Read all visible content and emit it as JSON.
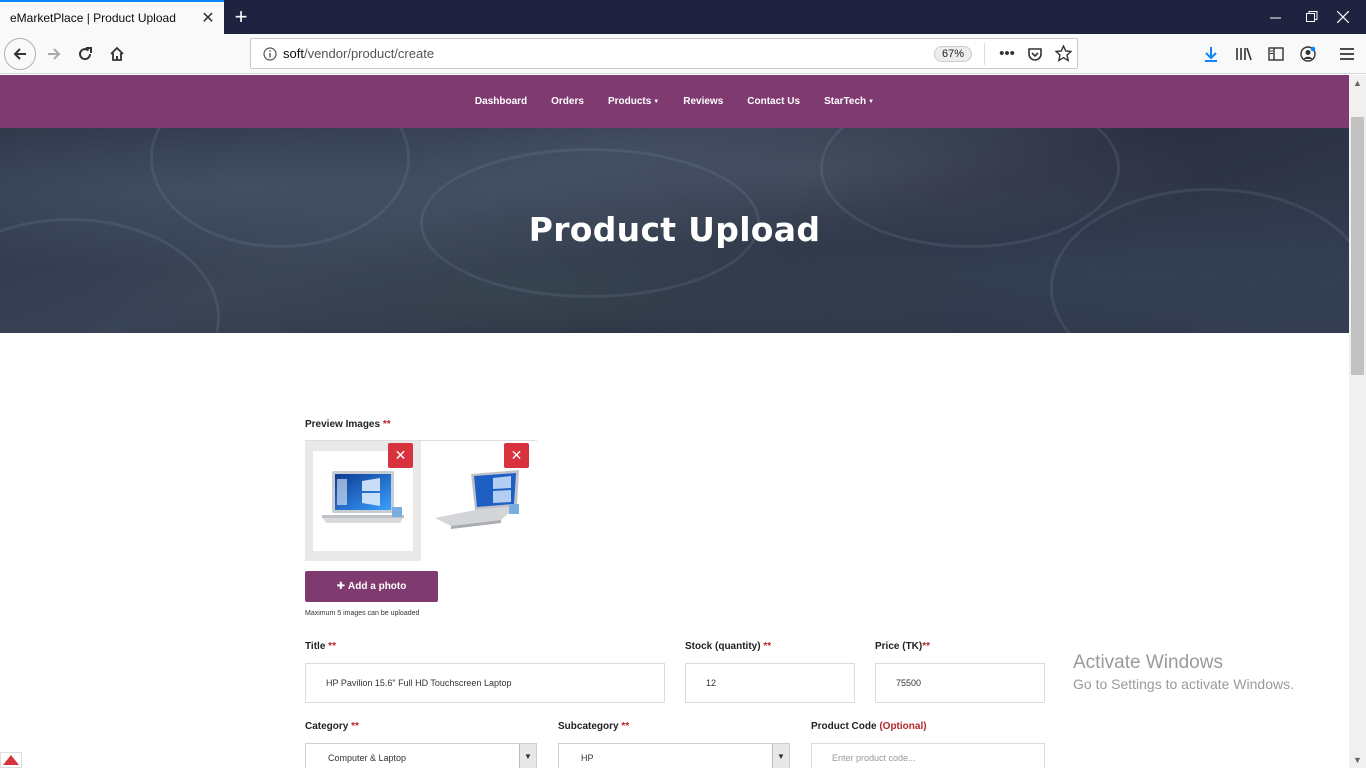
{
  "browser": {
    "tab_title": "eMarketPlace | Product Upload",
    "url_host": "soft",
    "url_path": "/vendor/product/create",
    "zoom": "67%"
  },
  "site_nav": {
    "items": [
      "Dashboard",
      "Orders",
      "Products",
      "Reviews",
      "Contact Us",
      "StarTech"
    ],
    "dropdown_items": [
      "Products",
      "StarTech"
    ]
  },
  "hero": {
    "title": "Product Upload"
  },
  "form": {
    "preview_label": "Preview Images",
    "required_mark": "**",
    "add_photo_label": "Add a photo",
    "max_images_hint": "Maximum 5 images can be uploaded",
    "title_label": "Title",
    "title_value": "HP Pavilion 15.6\" Full HD Touchscreen Laptop",
    "stock_label": "Stock (quantity)",
    "stock_value": "12",
    "price_label": "Price (TK)",
    "price_value": "75500",
    "category_label": "Category",
    "category_value": "Computer & Laptop",
    "subcategory_label": "Subcategory",
    "subcategory_value": "HP",
    "product_code_label": "Product Code",
    "product_code_optional": "(Optional)",
    "product_code_placeholder": "Enter product code..."
  },
  "watermark": {
    "line1": "Activate Windows",
    "line2": "Go to Settings to activate Windows."
  },
  "colors": {
    "brand": "#7f3a70",
    "danger": "#d9323f",
    "required": "#b3262d"
  }
}
